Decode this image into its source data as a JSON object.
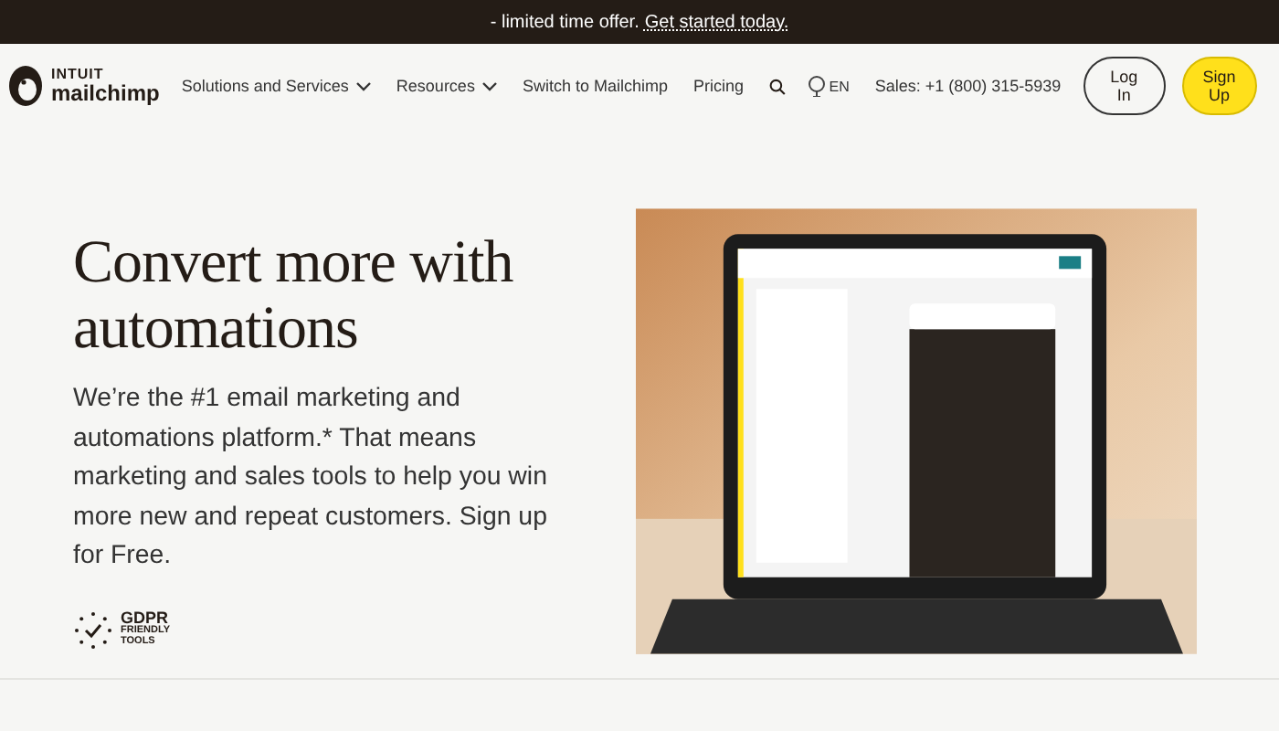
{
  "banner": {
    "text": "- limited time offer.",
    "link": "Get started today."
  },
  "nav": {
    "logo_top": "INTUIT",
    "logo_bottom": "mailchimp",
    "items": [
      {
        "label": "Solutions and Services",
        "dropdown": true
      },
      {
        "label": "Resources",
        "dropdown": true
      },
      {
        "label": "Switch to Mailchimp",
        "dropdown": false
      },
      {
        "label": "Pricing",
        "dropdown": false
      }
    ],
    "language": "EN",
    "sales": "Sales: +1 (800) 315-5939",
    "login": "Log In",
    "signup": "Sign Up"
  },
  "hero": {
    "title": "Convert more with automations",
    "body": "We’re the #1 email marketing and automations platform.* That means marketing and sales tools to help you win more new and repeat customers. Sign up for Free.",
    "badge_title": "GDPR",
    "badge_sub": "FRIENDLY TOOLS"
  }
}
